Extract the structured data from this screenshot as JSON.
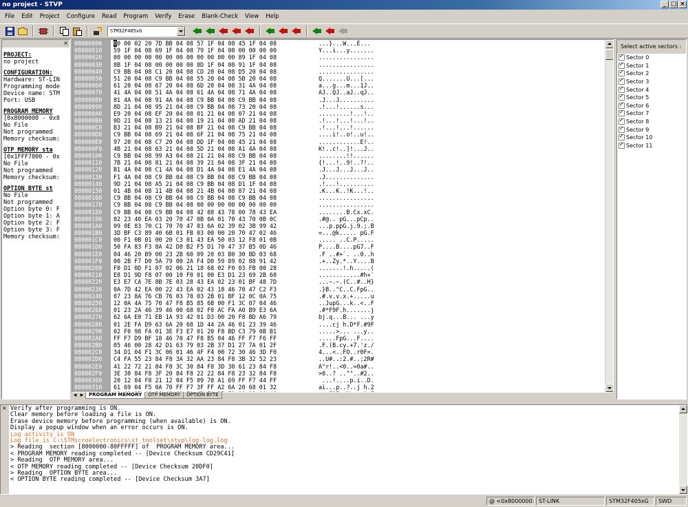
{
  "window": {
    "title": "no project - STVP"
  },
  "menu": [
    "File",
    "Edit",
    "Project",
    "Configure",
    "Read",
    "Program",
    "Verify",
    "Erase",
    "Blank-Check",
    "View",
    "Help"
  ],
  "toolbar": {
    "device": "STM32F405xG",
    "icons": [
      "save-icon",
      "open-folder-icon",
      "chip-icon",
      "copy-icon",
      "paste-icon",
      "device-select-icon",
      "read-icon",
      "program-icon",
      "verify-icon",
      "erase-icon",
      "blank-check-icon"
    ]
  },
  "info_panel": {
    "lines": [
      {
        "t": "PROJECT:",
        "h": true
      },
      {
        "t": "no project",
        "h": false
      },
      {
        "t": "CONFIGURATION:",
        "h": true
      },
      {
        "t": "Hardware: ST-LIN",
        "h": false
      },
      {
        "t": "Programming mode",
        "h": false
      },
      {
        "t": "Device name: STM",
        "h": false
      },
      {
        "t": "Port: USB",
        "h": false
      },
      {
        "t": "PROGRAM MEMORY",
        "h": true
      },
      {
        "t": "[0x8000000 - 0x8",
        "h": false
      },
      {
        "t": "No File",
        "h": false
      },
      {
        "t": "Not programmed",
        "h": false
      },
      {
        "t": "Memory checksum:",
        "h": false
      },
      {
        "t": "OTP MEMORY sta",
        "h": true
      },
      {
        "t": "[0x1FFF7800 - 0x",
        "h": false
      },
      {
        "t": "No File",
        "h": false
      },
      {
        "t": "Not programmed",
        "h": false
      },
      {
        "t": "Memory checksum:",
        "h": false
      },
      {
        "t": "OPTION BYTE st",
        "h": true
      },
      {
        "t": "No File",
        "h": false
      },
      {
        "t": "Not programmed",
        "h": false
      },
      {
        "t": "Option byte 0: F",
        "h": false
      },
      {
        "t": "Option byte 1: A",
        "h": false
      },
      {
        "t": "Option byte 2: F",
        "h": false
      },
      {
        "t": "Option byte 3: F",
        "h": false
      },
      {
        "t": "Memory checksum:",
        "h": false
      }
    ]
  },
  "hex": {
    "rows": [
      [
        "08000000",
        "00 00 02 20 7D BB 04 08 57 1F 04 08 45 1F 04 08",
        "...}...W...E..."
      ],
      [
        "08000010",
        "59 1F 04 08 69 1F 04 08 79 1F 04 08 00 00 00 00",
        "Y...i...y......."
      ],
      [
        "08000020",
        "00 00 00 00 00 00 00 00 00 00 00 00 89 1F 04 08",
        "................"
      ],
      [
        "08000030",
        "8B 1F 04 08 00 00 00 00 8D 1F 04 08 91 1F 04 08",
        "................"
      ],
      [
        "08000040",
        "C9 BB 04 08 C1 20 04 08 CD 20 04 08 D5 20 04 08",
        "................"
      ],
      [
        "08000050",
        "51 20 04 08 C9 BB 04 08 55 20 04 08 5B 20 04 08",
        "Q.......U...[..."
      ],
      [
        "08000060",
        "61 20 04 08 67 20 04 08 6D 20 04 08 31 4A 04 08",
        "a...g...m...1J.."
      ],
      [
        "08000070",
        "41 4A 04 08 51 4A 04 08 61 4A 04 08 71 4A 04 08",
        "AJ..QJ..aJ..qJ.."
      ],
      [
        "08000080",
        "81 4A 04 08 91 4A 04 08 C9 BB 04 08 C9 BB 04 08",
        ".J...J.........."
      ],
      [
        "08000090",
        "8D 21 04 08 95 21 04 08 C9 BB 04 08 73 20 04 08",
        ".!...!......s..."
      ],
      [
        "080000A0",
        "E9 20 04 08 EF 20 04 08 01 21 04 08 07 21 04 08",
        ".........!...!.."
      ],
      [
        "080000B0",
        "0D 21 04 08 13 21 04 08 19 21 04 08 AD 21 04 08",
        ".!...!...!...!.."
      ],
      [
        "080000C0",
        "B3 21 04 08 B9 21 04 08 BF 21 04 08 C9 BB 04 08",
        ".!...!...!......"
      ],
      [
        "080000D0",
        "C9 BB 04 08 69 21 04 08 6F 21 04 08 75 21 04 08",
        "....i!..o!..u!.."
      ],
      [
        "080000E0",
        "97 20 04 08 C7 20 04 08 DD 1F 04 08 45 21 04 08",
        "............E!.."
      ],
      [
        "080000F0",
        "4B 21 04 08 63 21 04 08 5D 21 04 08 A1 4A 04 08",
        "K!..c!..]!...J.."
      ],
      [
        "08000100",
        "C9 BB 04 08 99 A3 04 08 21 21 04 08 C9 BB 04 08",
        "........!!......"
      ],
      [
        "08000110",
        "7B 21 04 08 81 21 04 08 39 21 04 08 3F 21 04 08",
        "{!...!..9!..?!.."
      ],
      [
        "08000120",
        "B1 4A 04 08 C1 4A 04 08 D1 4A 04 08 E1 4A 04 08",
        ".J...J...J...J.."
      ],
      [
        "08000130",
        "F1 4A 04 08 C9 BB 04 08 C9 BB 04 08 C9 BB 04 08",
        ".J.............."
      ],
      [
        "08000140",
        "9D 21 04 08 A5 21 04 08 C9 BB 04 08 D1 1F 04 08",
        ".!...!.........."
      ],
      [
        "08000150",
        "01 4B 04 08 11 4B 04 08 21 4B 04 08 87 21 04 08",
        ".K...K..!K...!.."
      ],
      [
        "08000160",
        "C9 BB 04 08 C9 BB 04 08 C9 BB 04 08 C9 BB 04 08",
        "................"
      ],
      [
        "08000170",
        "C9 BB 04 08 C9 BB 04 08 00 00 00 00 00 00 00 00",
        "................"
      ],
      [
        "08000180",
        "C9 BB 04 08 C9 BB 04 08 42 88 43 78 00 78 43 EA",
        "........B.Cx.xC."
      ],
      [
        "08000190",
        "02 23 40 EA 03 20 70 47 0B 0A 01 70 43 70 0B 0C",
        ".#@.. pG...pCp.."
      ],
      [
        "080001A0",
        "09 0E 83 70 C1 70 70 47 03 6A 02 39 02 3B 99 42",
        "...p.ppG.j.9.;.B"
      ],
      [
        "080001B0",
        "3D BF C3 89 40 6B 01 FB 03 00 00 20 70 47 02 46",
        "=...@k..... pG.F"
      ],
      [
        "080001C0",
        "00 F1 0B 01 00 20 C3 01 43 EA 50 03 12 F8 01 0B",
        "..... ..C.P....."
      ],
      [
        "080001D0",
        "50 FA 83 F3 8A 42 D8 B2 F5 D1 70 47 37 B5 0D 46",
        "P....B....pG7..F"
      ],
      [
        "080001E0",
        "04 46 20 B9 00 23 2B 60 09 20 03 B0 30 BD 03 68",
        ".F ..#+`. ..0..h"
      ],
      [
        "080001F0",
        "00 2B F7 D0 5A 79 00 2A F4 D0 59 89 02 88 91 42",
        ".+..Zy.*..Y....B"
      ],
      [
        "08000200",
        "F0 D1 0D F1 07 02 06 21 18 68 02 F0 03 FB 00 28",
        ".......!.h.....("
      ],
      [
        "08000210",
        "E8 D1 9D F8 07 00 10 F0 01 00 E3 D1 23 69 2B 60",
        "............#h+`"
      ],
      [
        "08000220",
        "E3 E7 CA 7E 8B 7E 03 28 43 EA 02 23 01 BF 48 7D",
        "...~.~.(C..#..H}"
      ],
      [
        "08000230",
        "0A 7D 42 EA 00 22 43 EA 02 43 18 46 70 47 C2 F3",
        ".}B..\"C..C.FpG.."
      ],
      [
        "08000240",
        "07 23 8A 76 CB 76 03 78 03 2B 01 BF 12 0C 0A 75",
        ".#.v.v.x.+.....u"
      ],
      [
        "08000250",
        "12 0A 4A 75 70 47 F8 B5 85 6B 00 F1 3C 07 04 46",
        "..JupG...k..<..F"
      ],
      [
        "08000260",
        "01 23 2A 46 39 46 00 68 02 F0 AC FA A0 B9 E3 6A",
        ".#*F9F.h.......j"
      ],
      [
        "08000270",
        "62 6A E0 71 EB 1A 93 42 01 D3 00 20 F8 BD A6 79",
        "bj.q...B... ...y"
      ],
      [
        "08000280",
        "01 2E FA D9 63 6A 20 68 1D 44 2A 46 01 23 39 46",
        "....cj h.D*F.#9F"
      ],
      [
        "08000290",
        "02 F0 98 FA 01 3E F3 E7 01 20 F8 BD C3 79 0B B1",
        ".....>... ...y.."
      ],
      [
        "080002A0",
        "FF F7 D9 BF 18 46 70 47 F8 B5 04 46 FF F7 F6 FF",
        ".....FpG...F...."
      ],
      [
        "080002B0",
        "05 46 00 28 42 D1 63 79 03 2B 37 D1 27 7A 01 2F",
        ".F.(B.cy.+7.'z./"
      ],
      [
        "080002C0",
        "34 D1 04 F1 3C 06 01 46 4F F4 00 72 30 46 3D F0",
        "4...<..FO..r0F=."
      ],
      [
        "080002D0",
        "C4 FA 55 23 84 F8 3A 32 AA 23 84 F8 3B 32 52 23",
        "..U#..:2.#..;2R#"
      ],
      [
        "080002E0",
        "41 22 72 21 84 F8 3C 30 84 F8 3D 30 61 23 84 F8",
        "A\"r!..<0..=0a#.."
      ],
      [
        "080002F0",
        "3E 30 84 F8 3F 20 84 F8 22 22 84 F8 23 32 84 F8",
        ">0..? ..\"\"..#2.."
      ],
      [
        "08000300",
        "20 12 84 F8 21 12 04 F5 09 70 A1 69 FF F7 44 FF",
        " ...!....p.i..D."
      ],
      [
        "08000310",
        "61 69 04 F5 0A 70 FF F7 3F FF A2 6A 20 68 01 32",
        "ai...p..?..j h.2"
      ],
      [
        "08000320",
        "A2 63 3B 46 31 46 02 F0 4D FA 25 72 00 22 11 46",
        ".c;F1F..M.%r.\".F"
      ],
      [
        "08000330",
        "20 68 02 F0 6F FA 00 30 18 BF 01 20 F8 BD 83 6B",
        " h..o..0... ...k"
      ],
      [
        "08000340",
        "8B 42 70 B5 06 46 0D 46 12 D0 FF F7 A7 FF 04 46",
        ".Bp..F.F.......F"
      ]
    ]
  },
  "tabs": [
    "PROGRAM MEMORY",
    "OTP MEMORY",
    "OPTION BYTE"
  ],
  "sectors": {
    "header": "Select active sectors :",
    "items": [
      "Sector 0",
      "Sector 1",
      "Sector 2",
      "Sector 3",
      "Sector 4",
      "Sector 5",
      "Sector 6",
      "Sector 7",
      "Sector 8",
      "Sector 9",
      "Sector 10",
      "Sector 11"
    ]
  },
  "log": {
    "lines": [
      {
        "t": "Verify after programming is ON.",
        "c": ""
      },
      {
        "t": "Clear memory before loading a file is ON.",
        "c": ""
      },
      {
        "t": "Erase device memory before programming (when available) is ON.",
        "c": ""
      },
      {
        "t": "Display a popup window when an error occurs is ON.",
        "c": ""
      },
      {
        "t": "Log activity is ON",
        "c": "orange"
      },
      {
        "t": "Log file is C:\\STMicroelectronics\\st_toolset\\stvp\\log-log.log",
        "c": "orange"
      },
      {
        "t": "> Reading  section [8000000-80FFFFF] of  PROGRAM MEMORY area...",
        "c": ""
      },
      {
        "t": "< PROGRAM MEMORY reading completed -- [Device Checksum CD29C41]",
        "c": ""
      },
      {
        "t": "> Reading  OTP MEMORY area...",
        "c": ""
      },
      {
        "t": "< OTP MEMORY reading completed -- [Device Checksum 20DF0]",
        "c": ""
      },
      {
        "t": "> Reading  OPTION BYTE area...",
        "c": ""
      },
      {
        "t": "< OPTION BYTE reading completed -- [Device Checksum 3A7]",
        "c": ""
      }
    ]
  },
  "status": {
    "address": "@ <0x8000000>",
    "hardware": "ST-LINK",
    "device": "STM32F405xG",
    "mode": "SWD"
  }
}
